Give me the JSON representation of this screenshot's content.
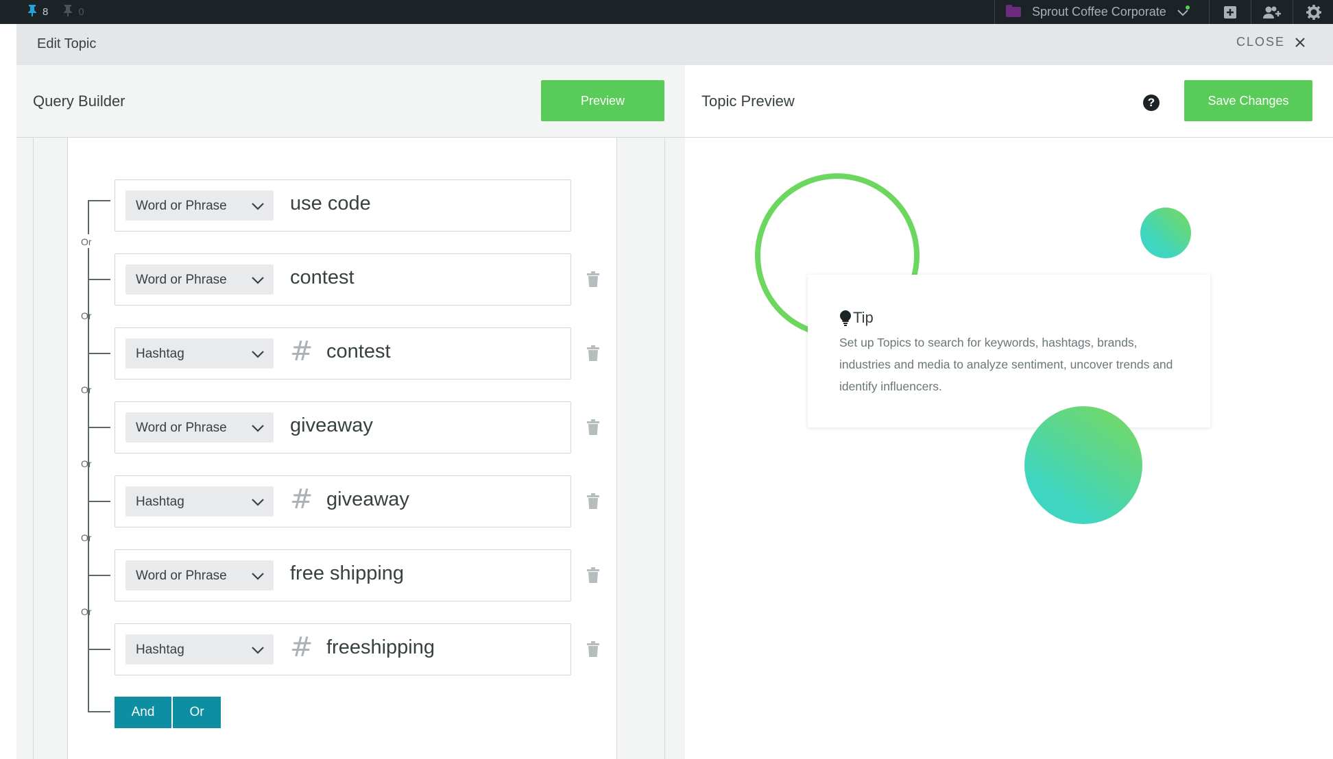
{
  "topbar": {
    "pins_count": "8",
    "users_count": "0",
    "org_name": "Sprout Coffee Corporate",
    "icons": [
      "pin-icon",
      "user-icon",
      "folder-icon",
      "chevron-down-icon",
      "compose-plus-icon",
      "add-user-icon",
      "gear-icon"
    ]
  },
  "header": {
    "title": "Edit Topic",
    "close_label": "CLOSE"
  },
  "query_builder": {
    "title": "Query Builder",
    "preview_label": "Preview",
    "connector_label": "Or",
    "rows": [
      {
        "type": "Word or Phrase",
        "value": "use code",
        "hash": ""
      },
      {
        "type": "Word or Phrase",
        "value": "contest",
        "hash": ""
      },
      {
        "type": "Hashtag",
        "value": "contest",
        "hash": "#"
      },
      {
        "type": "Word or Phrase",
        "value": "giveaway",
        "hash": ""
      },
      {
        "type": "Hashtag",
        "value": "giveaway",
        "hash": "#"
      },
      {
        "type": "Word or Phrase",
        "value": "free shipping",
        "hash": ""
      },
      {
        "type": "Hashtag",
        "value": "freeshipping",
        "hash": "#"
      }
    ],
    "and_label": "And",
    "or_label": "Or"
  },
  "topic_preview": {
    "title": "Topic Preview",
    "help_label": "?",
    "save_label": "Save Changes",
    "tip": {
      "title": "Tip",
      "text": "Set up Topics to search for keywords, hashtags, brands, industries and media to analyze sentiment, uncover trends and identify influencers."
    }
  },
  "colors": {
    "brand_green": "#59cb59",
    "teal": "#0d8ea3",
    "topbar": "#1b2326"
  }
}
